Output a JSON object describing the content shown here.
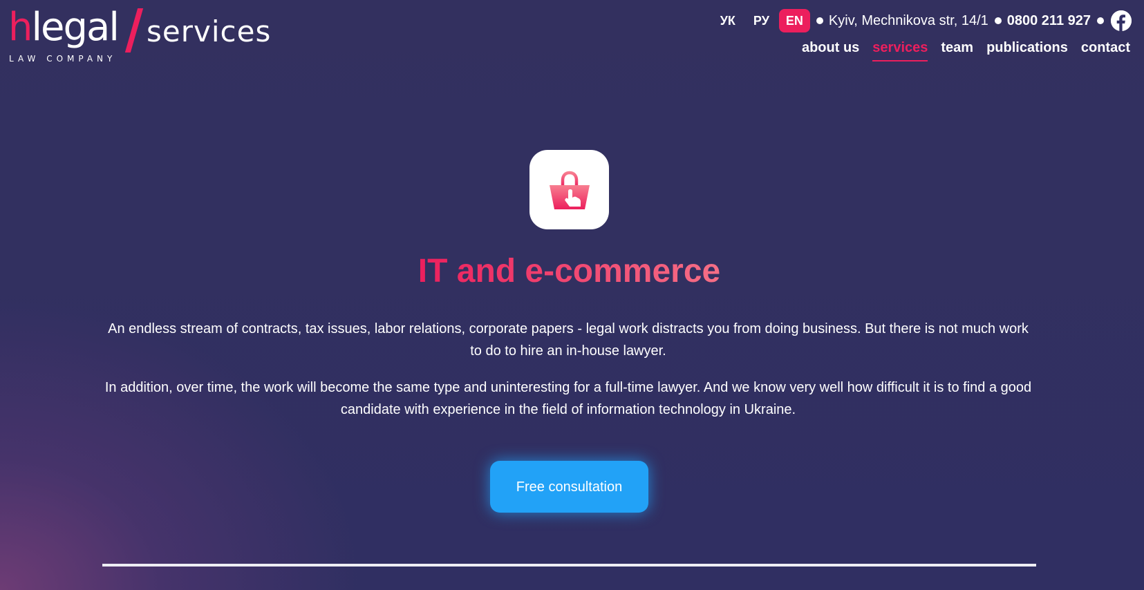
{
  "logo": {
    "h": "h",
    "legal": "legal",
    "services": "services",
    "tagline": "LAW COMPANY"
  },
  "topbar": {
    "languages": [
      "УК",
      "РУ",
      "EN"
    ],
    "active_language": "EN",
    "address": "Kyiv, Mechnikova str, 14/1",
    "phone": "0800 211 927",
    "social_icon": "facebook-icon"
  },
  "nav": {
    "items": [
      "about us",
      "services",
      "team",
      "publications",
      "contact"
    ],
    "active": "services"
  },
  "main": {
    "icon": "shopping-basket-cursor-icon",
    "title": "IT and e-commerce",
    "paragraphs": [
      "An endless stream of contracts, tax issues, labor relations, corporate papers - legal work distracts you from doing business. But there is not much work to do to hire an in-house lawyer.",
      "In addition, over time, the work will become the same type and uninteresting for a full-time lawyer. And we know very well how difficult it is to find a good candidate with experience in the field of information technology in Ukraine."
    ],
    "cta_label": "Free consultation"
  },
  "colors": {
    "background": "#312f63",
    "accent": "#ec1f5d",
    "button": "#22a2f7",
    "text": "#ffffff"
  }
}
